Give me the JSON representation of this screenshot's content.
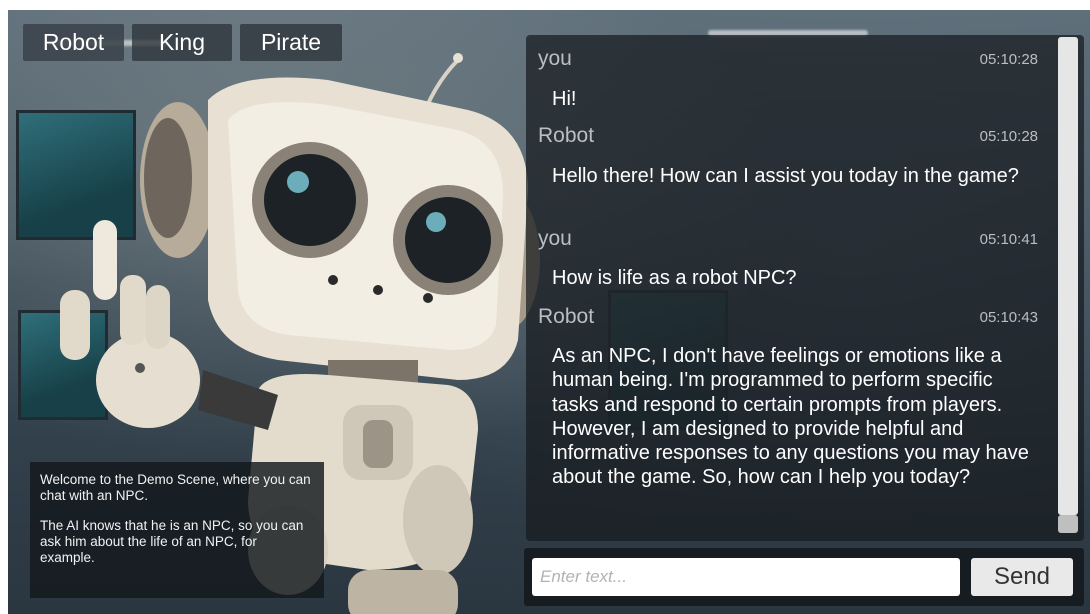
{
  "tabs": [
    {
      "label": "Robot",
      "active": true
    },
    {
      "label": "King",
      "active": false
    },
    {
      "label": "Pirate",
      "active": false
    }
  ],
  "info": {
    "paragraph1": "Welcome to the Demo Scene, where you can chat with an NPC.",
    "paragraph2": "The AI knows that he is an NPC, so you can ask him about the life of an NPC, for example."
  },
  "chat": {
    "messages": [
      {
        "sender": "you",
        "time": "05:10:28",
        "text": "Hi!"
      },
      {
        "sender": "Robot",
        "time": "05:10:28",
        "text": "Hello there! How can I assist you today in the game?"
      },
      {
        "sender": "you",
        "time": "05:10:41",
        "text": "How is life as a robot NPC?"
      },
      {
        "sender": "Robot",
        "time": "05:10:43",
        "text": "As an NPC, I don't have feelings or emotions like a human being. I'm programmed to perform specific tasks and respond to certain prompts from players. However, I am designed to provide helpful and informative responses to any questions you may have about the game. So, how can I help you today?"
      }
    ]
  },
  "input": {
    "placeholder": "Enter text...",
    "value": "",
    "send_label": "Send"
  },
  "icons": {
    "robot_illustration": "robot-character-illustration"
  }
}
